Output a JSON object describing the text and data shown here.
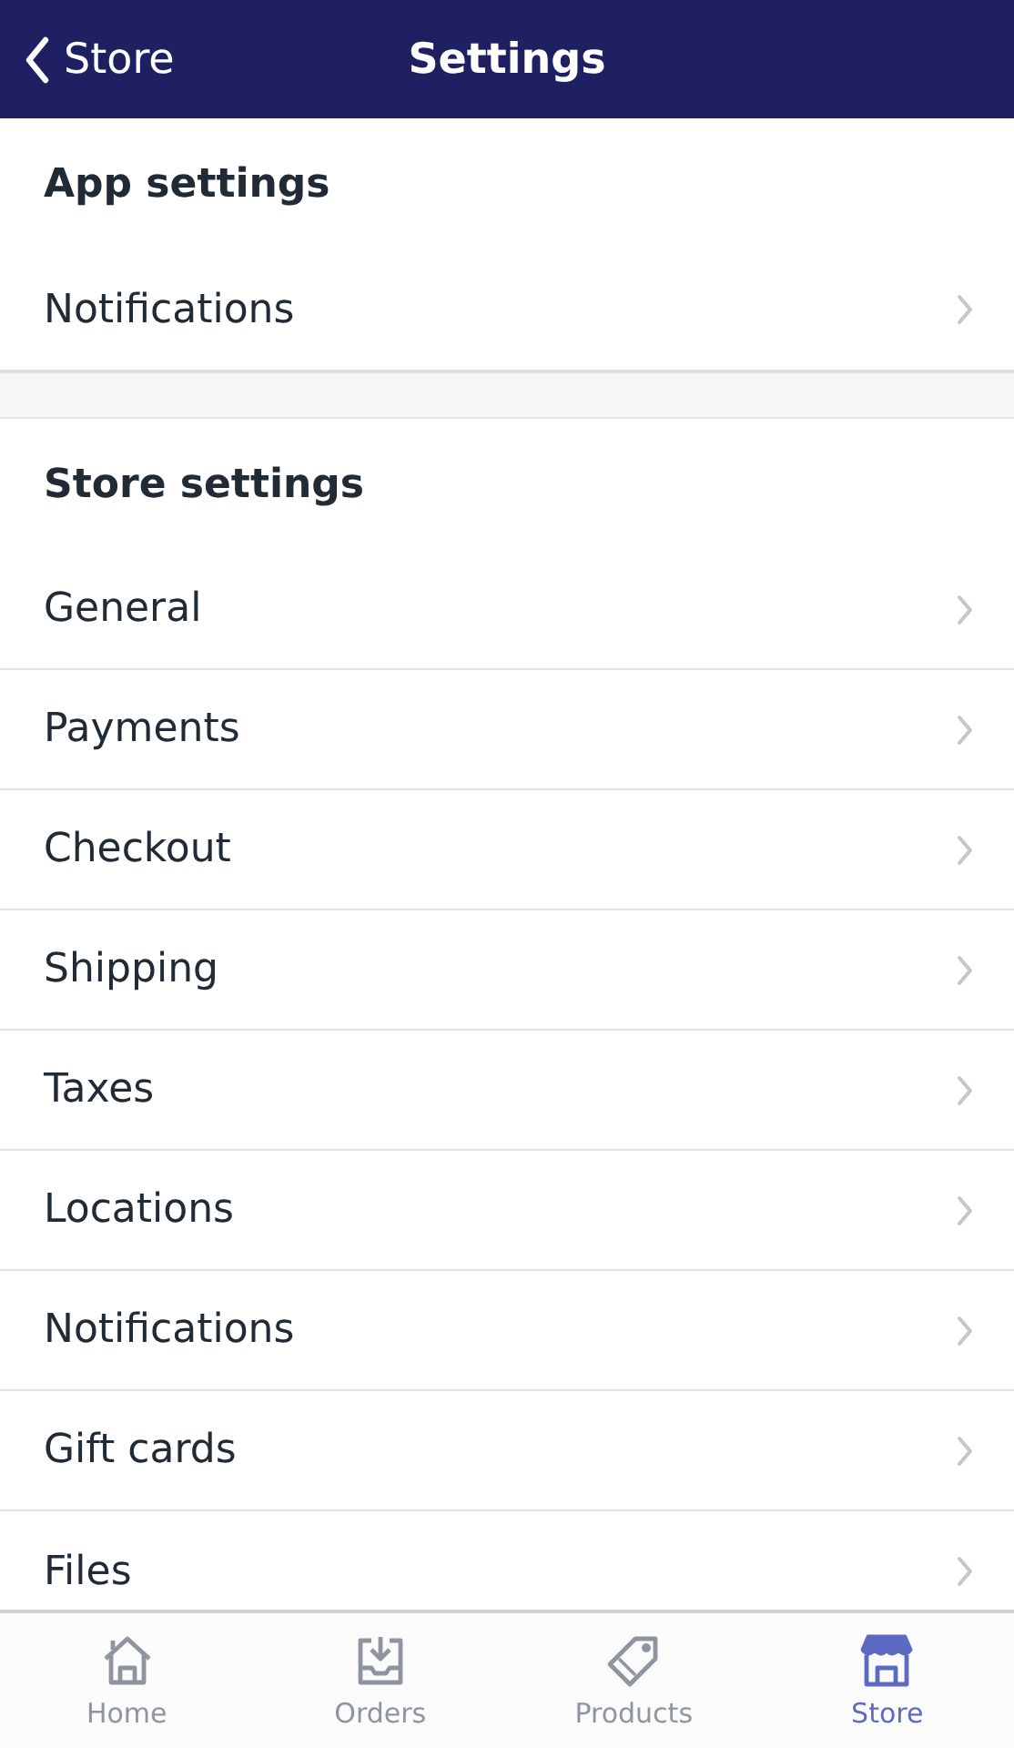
{
  "nav_bar": {
    "back_label": "Store",
    "title": "Settings"
  },
  "sections": [
    {
      "heading": "App settings",
      "items": [
        "Notifications"
      ]
    },
    {
      "heading": "Store settings",
      "items": [
        "General",
        "Payments",
        "Checkout",
        "Shipping",
        "Taxes",
        "Locations",
        "Notifications",
        "Gift cards",
        "Files"
      ]
    }
  ],
  "tab_bar": [
    {
      "label": "Home",
      "kind": "home",
      "selected": false
    },
    {
      "label": "Orders",
      "kind": "orders",
      "selected": false
    },
    {
      "label": "Products",
      "kind": "products",
      "selected": false
    },
    {
      "label": "Store",
      "kind": "store",
      "selected": true
    }
  ]
}
